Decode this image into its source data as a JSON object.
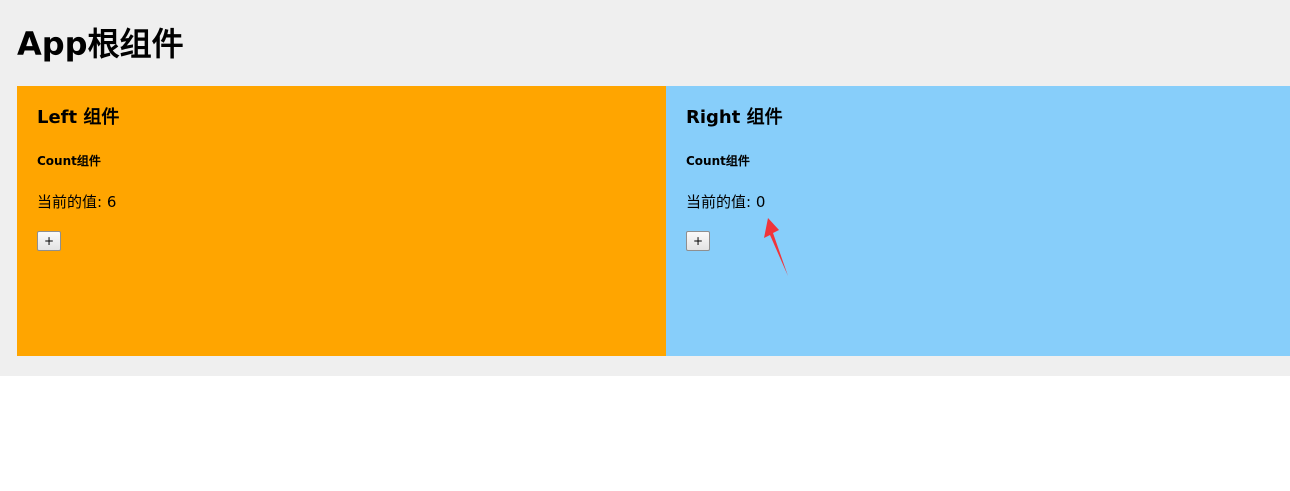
{
  "app": {
    "title": "App根组件"
  },
  "left": {
    "title": "Left 组件",
    "count": {
      "heading": "Count组件",
      "value_label": "当前的值: 6",
      "button_label": "+"
    }
  },
  "right": {
    "title": "Right 组件",
    "count": {
      "heading": "Count组件",
      "value_label": "当前的值: 0",
      "button_label": "+"
    }
  },
  "colors": {
    "app_background": "#efefef",
    "left_background": "#ffa500",
    "right_background": "#87cefa",
    "arrow": "#f0343a"
  },
  "annotations": {
    "arrow_icon": "red-arrow-icon"
  }
}
